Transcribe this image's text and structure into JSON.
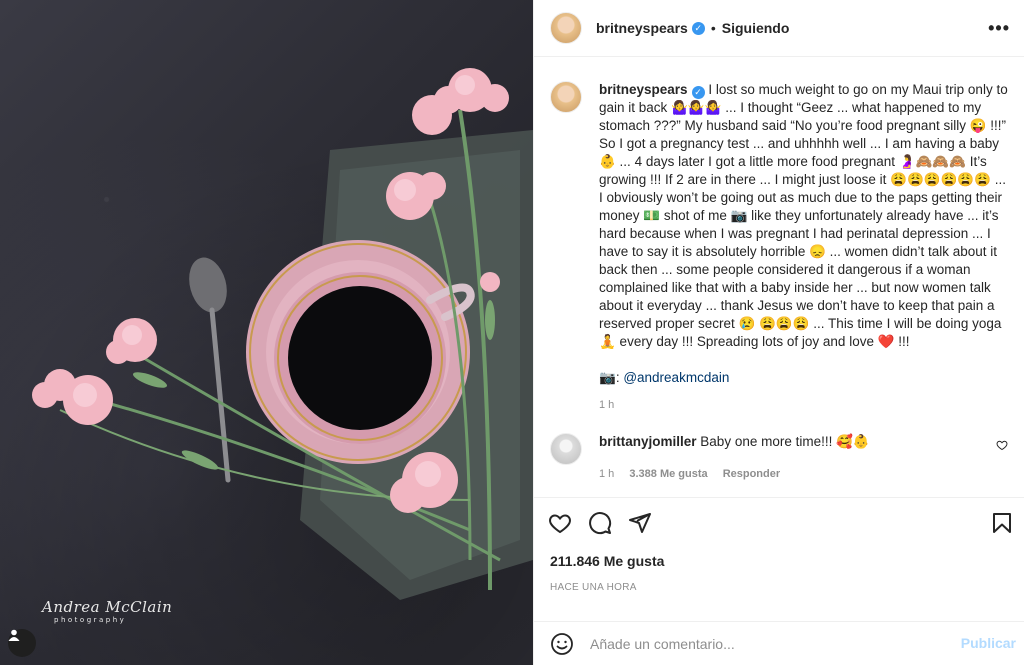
{
  "post": {
    "author": "britneyspears",
    "follow_state": "Siguiendo",
    "more_icon": "more-dots-icon",
    "caption": "I lost so much weight to go on my Maui trip only to gain it back 🤷‍♀️🤷‍♀️🤷‍♀️ ... I thought “Geez ... what happened to my stomach ???” My husband said “No you’re food pregnant silly 😜 !!!” So I got a pregnancy test ... and uhhhhh well ... I am having a baby 👶 ... 4 days later I got a little more food pregnant 🤰🙈🙈🙈 It’s growing !!! If 2 are in there ... I might just loose it 😩😩😩😩😩😩 ... I obviously won’t be going out as much due to the paps getting their money 💵 shot of me 📷 like they unfortunately already have ... it’s hard because when I was pregnant I had perinatal depression ... I have to say it is absolutely horrible 😞 ... women didn’t talk about it back then ... some people considered it dangerous if a woman complained like that with a baby inside her ... but now women talk about it everyday ... thank Jesus we don’t have to keep that pain a reserved proper secret 😢 😩😩😩 ... This time I will be doing yoga 🧘 every day !!! Spreading lots of joy and love ❤️ !!!",
    "credit_icon": "📷",
    "credit_handle": "@andreakmcdain",
    "caption_time": "1 h",
    "likes": "211.846 Me gusta",
    "time_ago": "HACE UNA HORA"
  },
  "comment": {
    "author": "brittanyjomiller",
    "text": "Baby one more time!!! 🥰👶",
    "time": "1 h",
    "likes": "3.388 Me gusta",
    "reply": "Responder"
  },
  "composer": {
    "placeholder": "Añade un comentario...",
    "publish": "Publicar"
  },
  "photo": {
    "watermark_name": "Andrea McClain",
    "watermark_sub": "photography"
  },
  "colors": {
    "verified": "#3897f0",
    "publish_disabled": "#b3dbff",
    "link": "#00376b"
  }
}
